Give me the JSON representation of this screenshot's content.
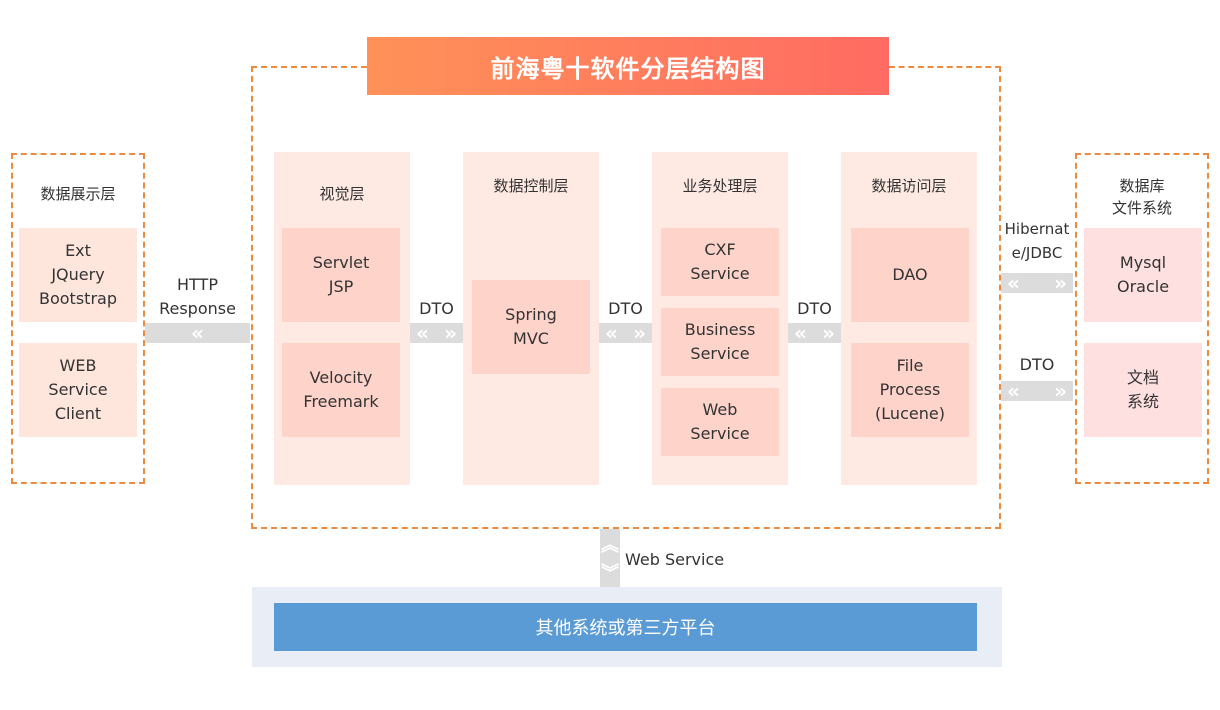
{
  "title": "前海粤十软件分层结构图",
  "colors": {
    "accent_dash": "#ec8a3f",
    "title_gradient_start": "#ff9158",
    "title_gradient_end": "#ff6b62",
    "layer_bg": "#fee9e3",
    "component_bg": "#fdd3ca",
    "presentation_bg": "#fee6dd",
    "storage_bg": "#fde0df",
    "connector_gray": "#dcdcdc",
    "platform_outer": "#e9eef6",
    "platform_inner": "#5b9bd5"
  },
  "presentation": {
    "title": "数据展示层",
    "items": [
      "Ext\nJQuery\nBootstrap",
      "WEB\nService\nClient"
    ]
  },
  "layers": [
    {
      "title": "视觉层",
      "items": [
        "Servlet\nJSP",
        "Velocity\nFreemark"
      ]
    },
    {
      "title": "数据控制层",
      "items": [
        "Spring\nMVC"
      ]
    },
    {
      "title": "业务处理层",
      "items": [
        "CXF\nService",
        "Business\nService",
        "Web\nService"
      ]
    },
    {
      "title": "数据访问层",
      "items": [
        "DAO",
        "File\nProcess\n(Lucene)"
      ]
    }
  ],
  "storage": {
    "title": "数据库\n文件系统",
    "items": [
      "Mysql\nOracle",
      "文档\n系统"
    ]
  },
  "connectors": {
    "http": {
      "label": "HTTP\nResponse",
      "glyph_left": "«"
    },
    "dto": "DTO",
    "glyph_left": "«",
    "glyph_right": "»",
    "glyph_up": "︽",
    "glyph_down": "︾",
    "hibernate": "Hibernat\ne/JDBC",
    "webservice": "Web Service"
  },
  "platform": {
    "label": "其他系统或第三方平台"
  }
}
